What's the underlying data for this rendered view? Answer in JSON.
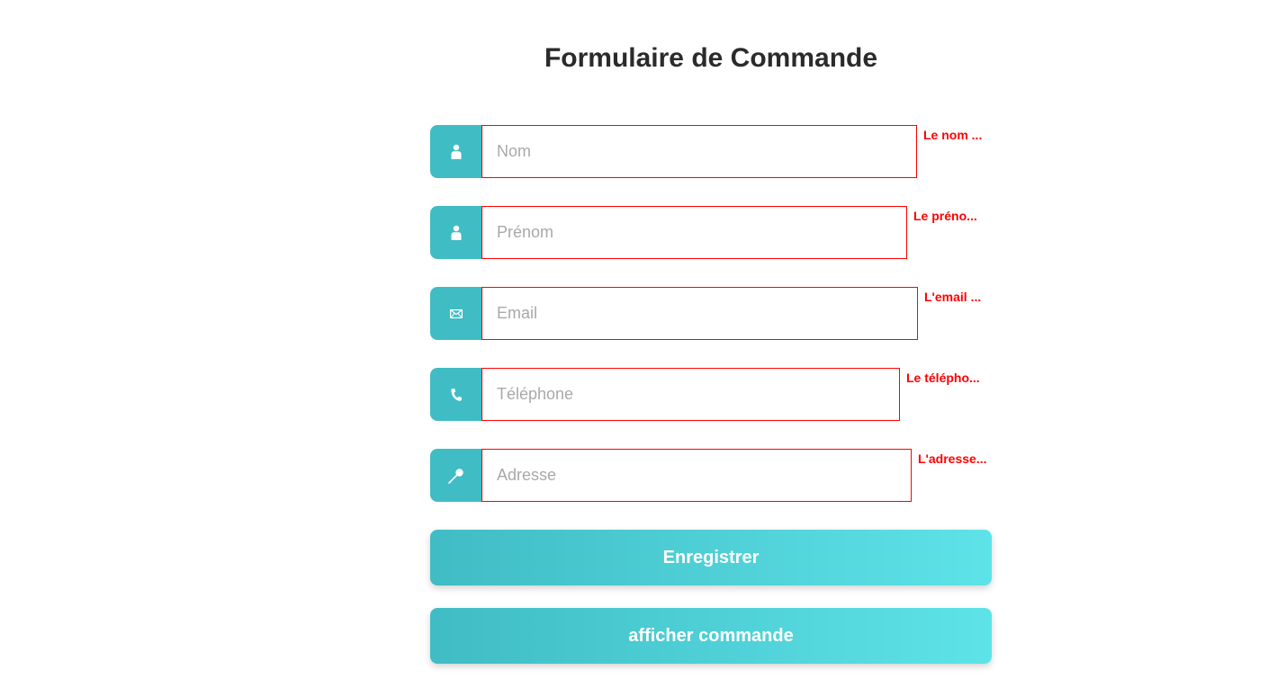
{
  "form": {
    "title": "Formulaire de Commande",
    "fields": [
      {
        "name": "nom",
        "icon": "person-icon",
        "placeholder": "Nom",
        "value": "",
        "error": "Le nom ..."
      },
      {
        "name": "prenom",
        "icon": "person-icon",
        "placeholder": "Prénom",
        "value": "",
        "error": "Le préno..."
      },
      {
        "name": "email",
        "icon": "envelope-icon",
        "placeholder": "Email",
        "value": "",
        "error": "L'email ..."
      },
      {
        "name": "telephone",
        "icon": "phone-icon",
        "placeholder": "Téléphone",
        "value": "",
        "error": "Le télépho..."
      },
      {
        "name": "adresse",
        "icon": "pin-icon",
        "placeholder": "Adresse",
        "value": "",
        "error": "L'adresse..."
      }
    ],
    "buttons": {
      "save_label": "Enregistrer",
      "show_orders_label": "afficher commande"
    }
  },
  "colors": {
    "accent": "#40bcc4",
    "accent_light": "#5de3e8",
    "error": "#ff0000",
    "title": "#2b2b2b"
  }
}
